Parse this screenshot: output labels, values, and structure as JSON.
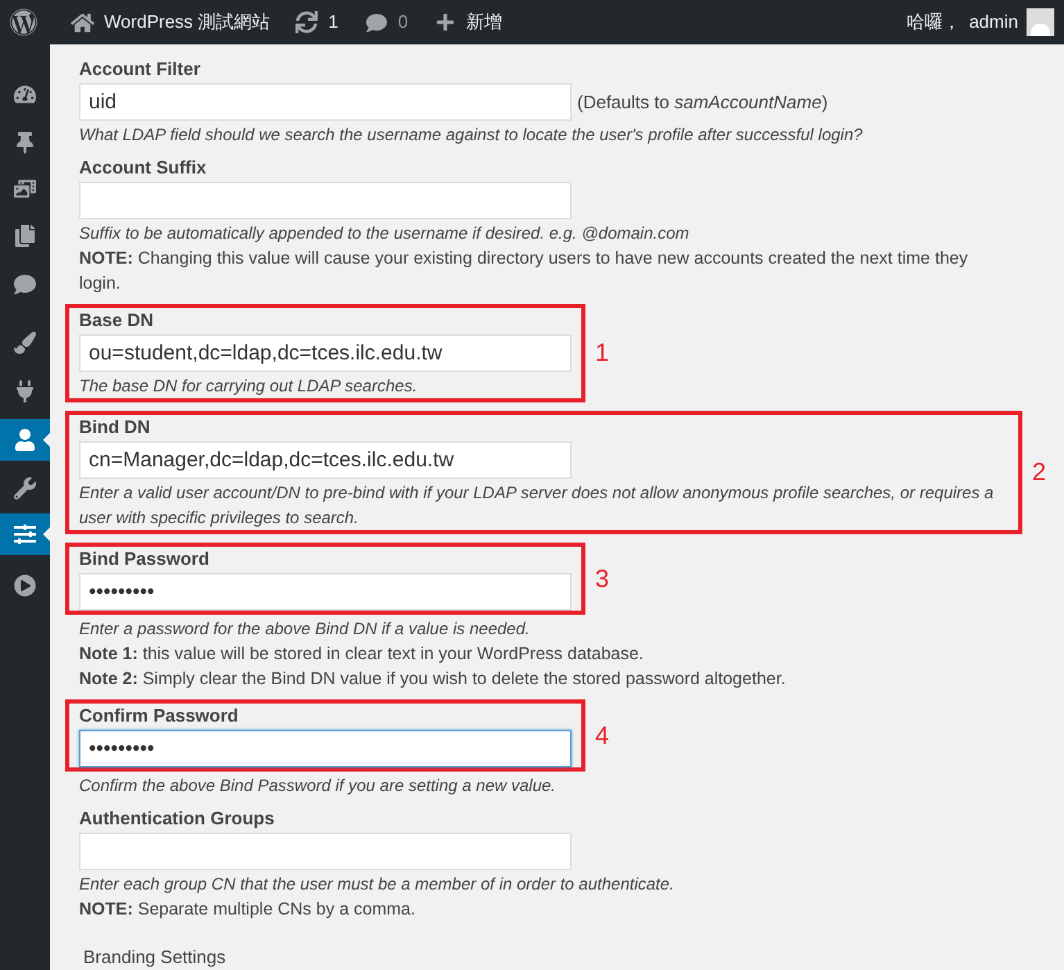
{
  "top_bar": {
    "site_name": "WordPress 測試網站",
    "updates": "1",
    "comments": "0",
    "new_label": "新增",
    "greeting": "哈囉，",
    "user": "admin"
  },
  "sidebar": {
    "items": [
      {
        "selected": false
      },
      {
        "selected": false
      },
      {
        "selected": false
      },
      {
        "selected": false
      },
      {
        "selected": false
      },
      {
        "selected": false
      },
      {
        "selected": false
      },
      {
        "selected": true
      },
      {
        "selected": false
      },
      {
        "selected": true
      },
      {
        "selected": false
      }
    ]
  },
  "fields": [
    {
      "label": "Account Filter",
      "value": "uid",
      "focused": false,
      "suffix": "(Defaults to *samAccountName*)",
      "lines": [
        {
          "kind": "hint",
          "text": "What LDAP field should we search the username against to locate the user's profile after successful login?"
        }
      ]
    },
    {
      "label": "Account Suffix",
      "focused": false,
      "lines": [
        {
          "kind": "hint",
          "text": "Suffix to be automatically appended to the username if desired. e.g. @domain.com"
        },
        {
          "kind": "note",
          "text": "**NOTE:** Changing this value will cause your existing directory users to have new accounts created the next time they login."
        }
      ]
    },
    {
      "label": "Base DN",
      "value": "ou=student,dc=ldap,dc=tces.ilc.edu.tw",
      "focused": false,
      "annotation": "1",
      "frame_holds_lines": true,
      "lines": [
        {
          "kind": "hint",
          "text": "The base DN for carrying out LDAP searches."
        }
      ]
    },
    {
      "label": "Bind DN",
      "value": "cn=Manager,dc=ldap,dc=tces.ilc.edu.tw",
      "focused": false,
      "annotation": "2",
      "frame_holds_lines": true,
      "lines": [
        {
          "kind": "hint",
          "text": "Enter a valid user account/DN to pre-bind with if your LDAP server does not allow anonymous profile searches, or requires a user with specific privileges to search."
        }
      ]
    },
    {
      "label": "Bind Password",
      "value": "•••••••••",
      "focused": false,
      "annotation": "3",
      "frame_holds_lines": false,
      "lines": [
        {
          "kind": "hint",
          "text": "Enter a password for the above Bind DN if a value is needed."
        },
        {
          "kind": "note",
          "text": "**Note 1:** this value will be stored in clear text in your WordPress database."
        },
        {
          "kind": "note",
          "text": "**Note 2:** Simply clear the Bind DN value if you wish to delete the stored password altogether."
        }
      ]
    },
    {
      "label": "Confirm Password",
      "value": "•••••••••",
      "focused": true,
      "annotation": "4",
      "frame_holds_lines": false,
      "lines": [
        {
          "kind": "hint",
          "text": "Confirm the above Bind Password if you are setting a new value."
        }
      ]
    },
    {
      "label": "Authentication Groups",
      "focused": false,
      "lines": [
        {
          "kind": "hint",
          "text": "Enter each group CN that the user must be a member of in order to authenticate."
        },
        {
          "kind": "note",
          "text": "**NOTE:** Separate multiple CNs by a comma."
        }
      ]
    }
  ],
  "section_heading": "Branding Settings"
}
